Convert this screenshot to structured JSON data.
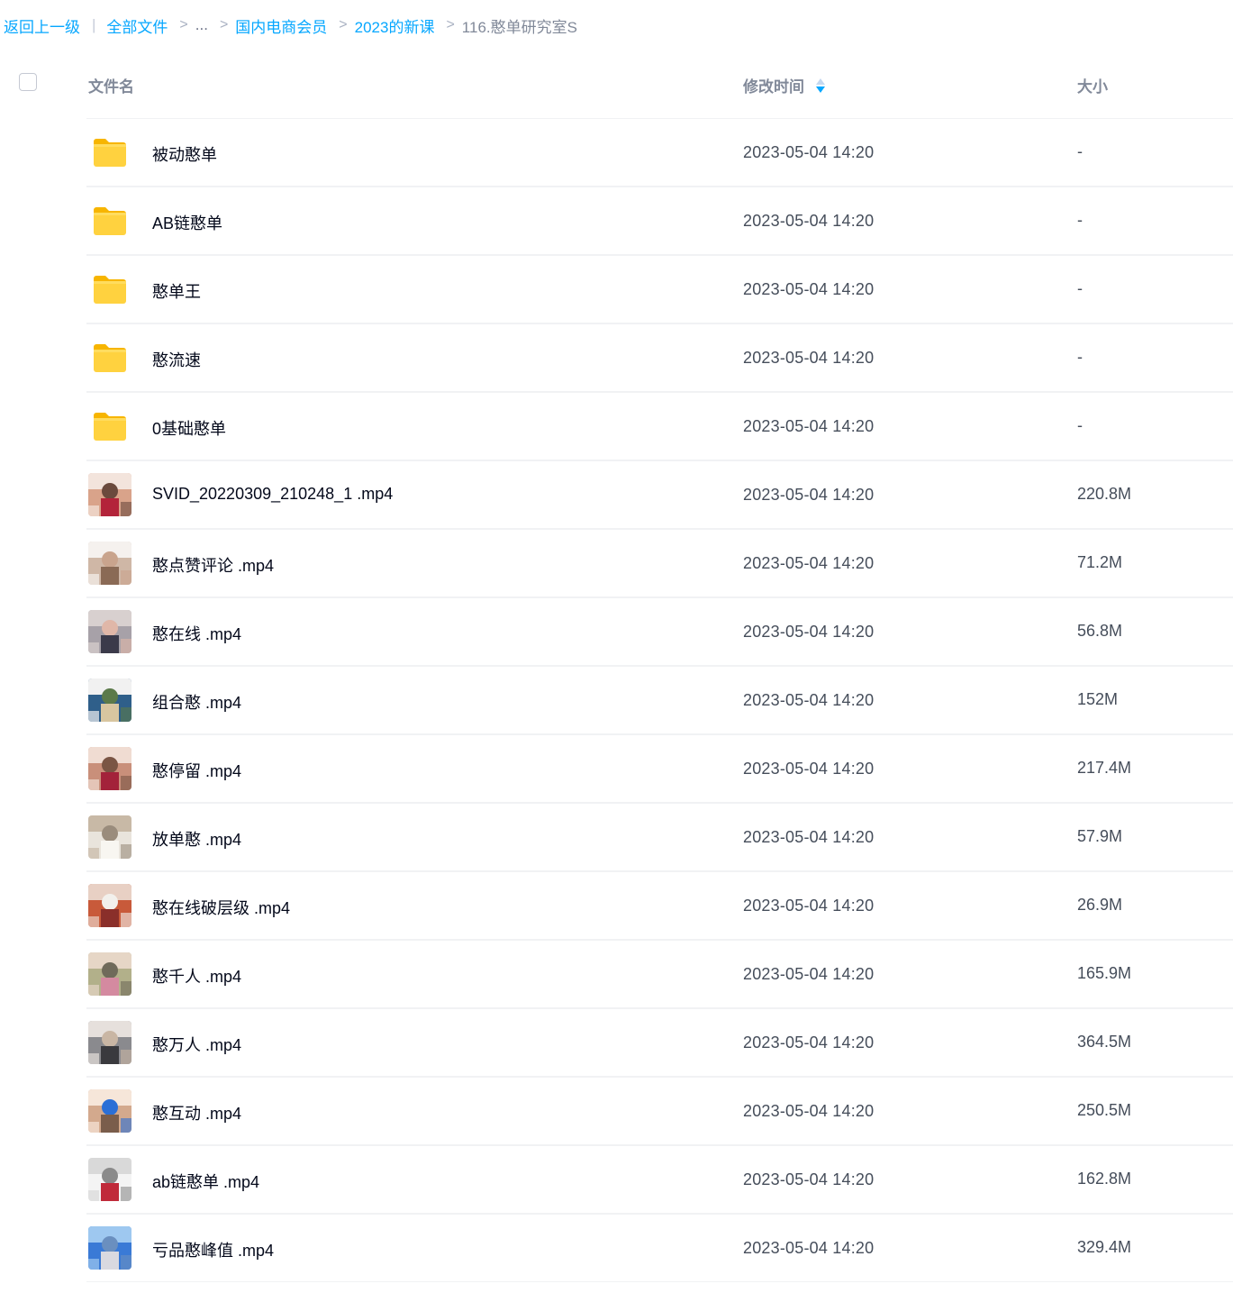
{
  "breadcrumb": {
    "back": "返回上一级",
    "root": "全部文件",
    "ellipsis": "...",
    "level1": "国内电商会员",
    "level2": "2023的新课",
    "current": "116.憨单研究室S",
    "pipe": "|",
    "sep": ">"
  },
  "header": {
    "name": "文件名",
    "time": "修改时间",
    "size": "大小"
  },
  "files": [
    {
      "name": "被动憨单",
      "time": "2023-05-04 14:20",
      "size": "-",
      "type": "folder"
    },
    {
      "name": "AB链憨单",
      "time": "2023-05-04 14:20",
      "size": "-",
      "type": "folder"
    },
    {
      "name": "憨单王",
      "time": "2023-05-04 14:20",
      "size": "-",
      "type": "folder"
    },
    {
      "name": "憨流速",
      "time": "2023-05-04 14:20",
      "size": "-",
      "type": "folder"
    },
    {
      "name": "0基础憨单",
      "time": "2023-05-04 14:20",
      "size": "-",
      "type": "folder"
    },
    {
      "name": "SVID_20220309_210248_1 .mp4",
      "time": "2023-05-04 14:20",
      "size": "220.8M",
      "type": "video"
    },
    {
      "name": "憨点赞评论 .mp4",
      "time": "2023-05-04 14:20",
      "size": "71.2M",
      "type": "video"
    },
    {
      "name": "憨在线 .mp4",
      "time": "2023-05-04 14:20",
      "size": "56.8M",
      "type": "video"
    },
    {
      "name": "组合憨 .mp4",
      "time": "2023-05-04 14:20",
      "size": "152M",
      "type": "video"
    },
    {
      "name": "憨停留 .mp4",
      "time": "2023-05-04 14:20",
      "size": "217.4M",
      "type": "video"
    },
    {
      "name": "放单憨 .mp4",
      "time": "2023-05-04 14:20",
      "size": "57.9M",
      "type": "video"
    },
    {
      "name": "憨在线破层级 .mp4",
      "time": "2023-05-04 14:20",
      "size": "26.9M",
      "type": "video"
    },
    {
      "name": "憨千人 .mp4",
      "time": "2023-05-04 14:20",
      "size": "165.9M",
      "type": "video"
    },
    {
      "name": "憨万人 .mp4",
      "time": "2023-05-04 14:20",
      "size": "364.5M",
      "type": "video"
    },
    {
      "name": "憨互动 .mp4",
      "time": "2023-05-04 14:20",
      "size": "250.5M",
      "type": "video"
    },
    {
      "name": "ab链憨单 .mp4",
      "time": "2023-05-04 14:20",
      "size": "162.8M",
      "type": "video"
    },
    {
      "name": "亏品憨峰值 .mp4",
      "time": "2023-05-04 14:20",
      "size": "329.4M",
      "type": "video"
    }
  ],
  "colors": {
    "link": "#06a7ff",
    "folder": "#ffcc33",
    "text": "#03081a",
    "muted": "#818999"
  },
  "icons": {
    "folder": "folder-icon",
    "video": "video-thumbnail",
    "sort": "sort-icon",
    "checkbox": "select-all-checkbox"
  }
}
